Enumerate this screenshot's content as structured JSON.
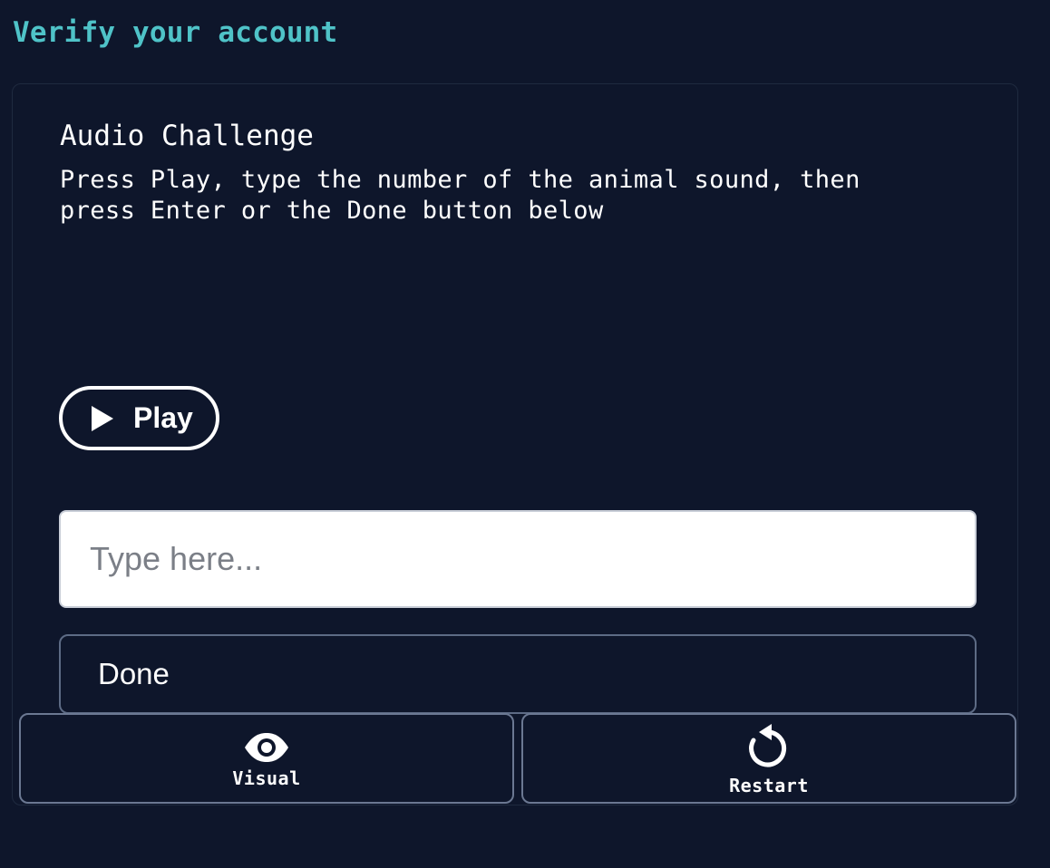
{
  "header": {
    "title": "Verify your account"
  },
  "challenge": {
    "title": "Audio Challenge",
    "instructions": "Press Play, type the number of the animal sound, then press Enter or the Done button below",
    "play_label": "Play",
    "play_icon": "play-icon",
    "input": {
      "value": "",
      "placeholder": "Type here..."
    },
    "done_label": "Done"
  },
  "footer": {
    "visual": {
      "label": "Visual",
      "icon": "eye-icon"
    },
    "restart": {
      "label": "Restart",
      "icon": "restart-icon"
    }
  },
  "colors": {
    "background": "#0e162b",
    "accent": "#4fc3c8",
    "text": "#ffffff",
    "input_background": "#ffffff",
    "button_border": "#6b7892"
  }
}
